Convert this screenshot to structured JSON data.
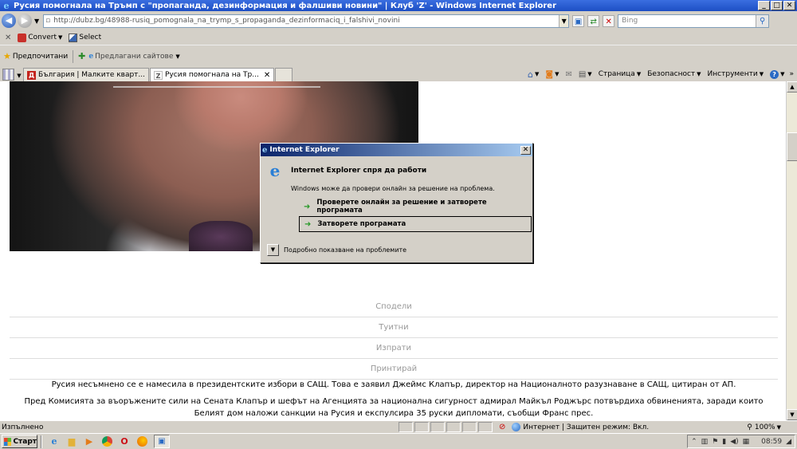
{
  "window": {
    "title": "Русия помогнала на Тръмп с \"пропаганда, дезинформация и фалшиви новини\" | Клуб 'Z' - Windows Internet Explorer",
    "controls": [
      "_",
      "□",
      "✕"
    ]
  },
  "address_bar": {
    "url": "http://dubz.bg/48988-rusiq_pomognala_na_trymp_s_propaganda_dezinformaciq_i_falshivi_novini",
    "search_placeholder": "Bing"
  },
  "command_bar": {
    "items": [
      {
        "label": "Convert"
      },
      {
        "label": "Select"
      }
    ]
  },
  "favorites_bar": {
    "favorites_label": "Предпочитани",
    "suggested_label": "Предлагани сайтове"
  },
  "tabs": [
    {
      "label": "България | Малките кварт...",
      "active": false
    },
    {
      "label": "Русия помогнала на Тр...",
      "active": true
    }
  ],
  "tab_commands": {
    "page": "Страница",
    "safety": "Безопасност",
    "tools": "Инструменти"
  },
  "content": {
    "share_items": [
      "Сподели",
      "Туитни",
      "Изпрати",
      "Принтирай"
    ],
    "paragraphs": [
      "Русия несъмнено се е намесила в президентските избори в САЩ. Това е заявил Джеймс Клапър, директор на Националното разузнаване в САЩ, цитиран от АП.",
      "Пред Комисията за въоръжените сили на Сената Клапър и шефът на Агенцията за национална сигурност адмирал Майкъл Роджърс потвърдиха обвиненията, заради които Белият дом наложи санкции на Русия и експулсира 35 руски дипломати, съобщи Франс прес."
    ]
  },
  "dialog": {
    "title": "Internet Explorer",
    "heading": "Internet Explorer спря да работи",
    "subtext": "Windows може да провери онлайн за решение на проблема.",
    "option1": "Проверете онлайн за решение и затворете програмата",
    "option2": "Затворете програмата",
    "details": "Подробно показване на проблемите"
  },
  "status_bar": {
    "status": "Изпълнено",
    "zone": "Интернет | Защитен режим: Вкл.",
    "zoom": "100%"
  },
  "taskbar": {
    "start_label": "Старт",
    "clock": "08:59"
  }
}
